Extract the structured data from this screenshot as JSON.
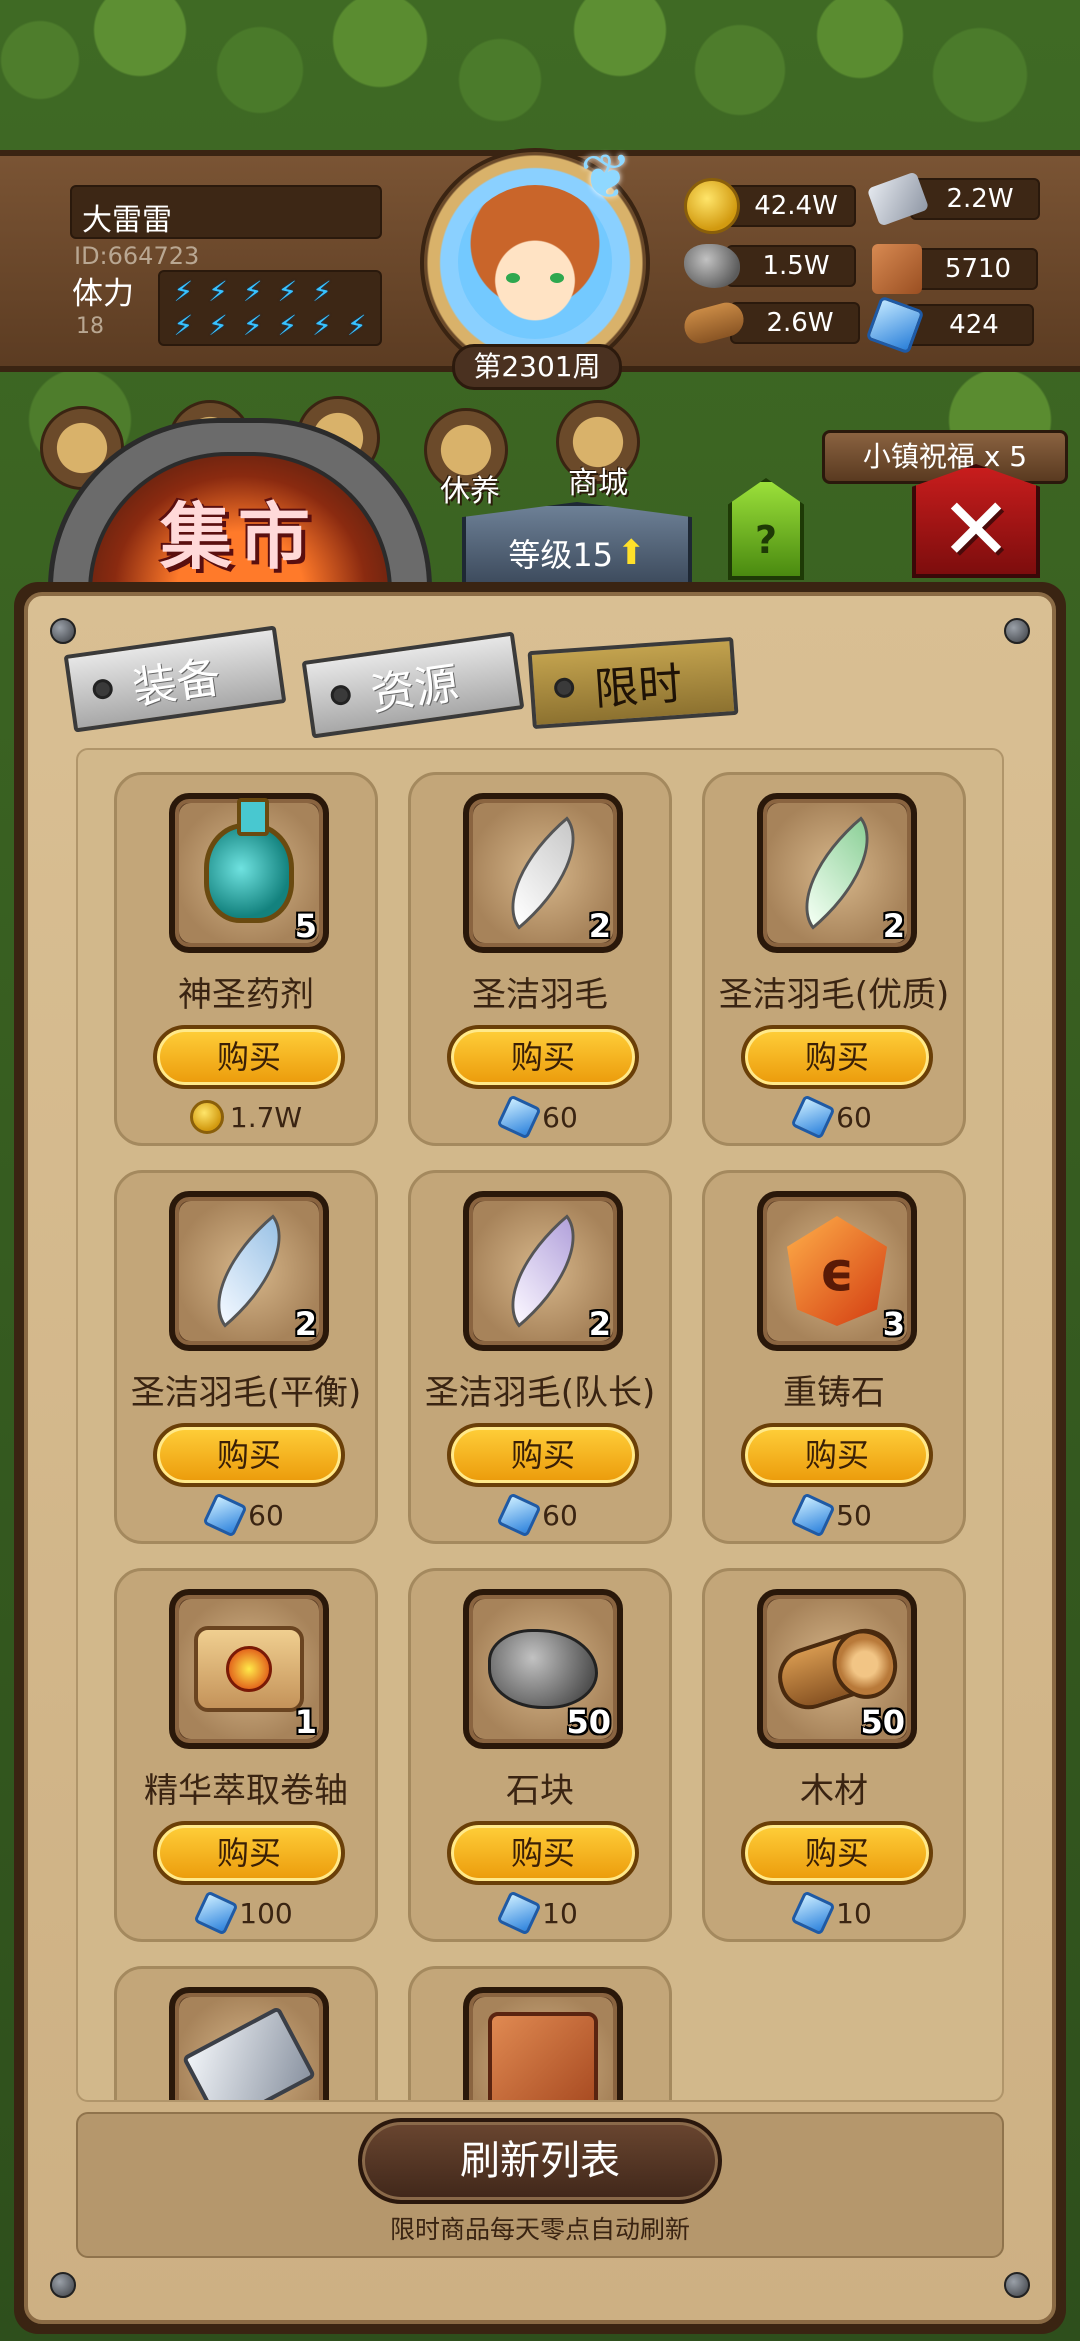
{
  "player": {
    "name": "大雷雷",
    "id": "ID:664723",
    "stamina_label": "体力",
    "stamina_value": "18",
    "week": "第2301周"
  },
  "resources": {
    "gold": "42.4W",
    "iron": "2.2W",
    "stone": "1.5W",
    "leather": "5710",
    "wood": "2.6W",
    "gem": "424"
  },
  "nav": {
    "rest_label": "休养",
    "shop_label": "商城",
    "blessing": "小镇祝福 x 5",
    "level": "等级15",
    "help": "?"
  },
  "market": {
    "title": "集市",
    "tabs": [
      "装备",
      "资源",
      "限时"
    ],
    "active_tab": "限时",
    "buy_label": "购买",
    "refresh_label": "刷新列表",
    "refresh_note": "限时商品每天零点自动刷新"
  },
  "items": [
    {
      "name": "神圣药剂",
      "qty": "5",
      "currency": "gold",
      "price": "1.7W",
      "icon": "potion-icon"
    },
    {
      "name": "圣洁羽毛",
      "qty": "2",
      "currency": "gem",
      "price": "60",
      "icon": "white-feather-icon",
      "color": "#f2f2f2"
    },
    {
      "name": "圣洁羽毛(优质)",
      "qty": "2",
      "currency": "gem",
      "price": "60",
      "icon": "green-feather-icon",
      "color": "#bfe8c4"
    },
    {
      "name": "圣洁羽毛(平衡)",
      "qty": "2",
      "currency": "gem",
      "price": "60",
      "icon": "blue-feather-icon",
      "color": "#cfe4f6"
    },
    {
      "name": "圣洁羽毛(队长)",
      "qty": "2",
      "currency": "gem",
      "price": "60",
      "icon": "purple-feather-icon",
      "color": "#ddd2f2"
    },
    {
      "name": "重铸石",
      "qty": "3",
      "currency": "gem",
      "price": "50",
      "icon": "reforge-stone-icon"
    },
    {
      "name": "精华萃取卷轴",
      "qty": "1",
      "currency": "gem",
      "price": "100",
      "icon": "scroll-icon"
    },
    {
      "name": "石块",
      "qty": "50",
      "currency": "gem",
      "price": "10",
      "icon": "stone-icon"
    },
    {
      "name": "木材",
      "qty": "50",
      "currency": "gem",
      "price": "10",
      "icon": "wood-icon"
    },
    {
      "name": "",
      "qty": "",
      "currency": "",
      "price": "",
      "icon": "iron-icon"
    },
    {
      "name": "",
      "qty": "",
      "currency": "",
      "price": "",
      "icon": "leather-icon"
    }
  ],
  "crystal_glyph": "ϵ"
}
